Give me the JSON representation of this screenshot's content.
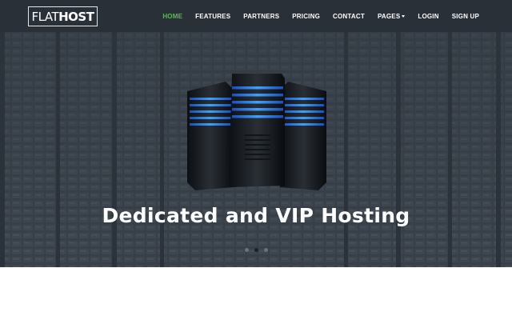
{
  "logo": {
    "flat": "FLAT",
    "host": "HOST"
  },
  "nav": {
    "items": [
      {
        "label": "HOME",
        "active": true
      },
      {
        "label": "FEATURES"
      },
      {
        "label": "PARTNERS"
      },
      {
        "label": "PRICING"
      },
      {
        "label": "CONTACT"
      },
      {
        "label": "PAGES",
        "dropdown": true
      },
      {
        "label": "LOGIN"
      },
      {
        "label": "SIGN UP"
      }
    ]
  },
  "hero": {
    "title": "Dedicated and VIP Hosting",
    "slides": 3,
    "active_slide": 1
  },
  "colors": {
    "topbar": "#2a3038",
    "accent": "#5cb85c",
    "server_glow": "#2f8cff"
  },
  "icons": [
    "server-illustration",
    "caret-down-icon"
  ]
}
